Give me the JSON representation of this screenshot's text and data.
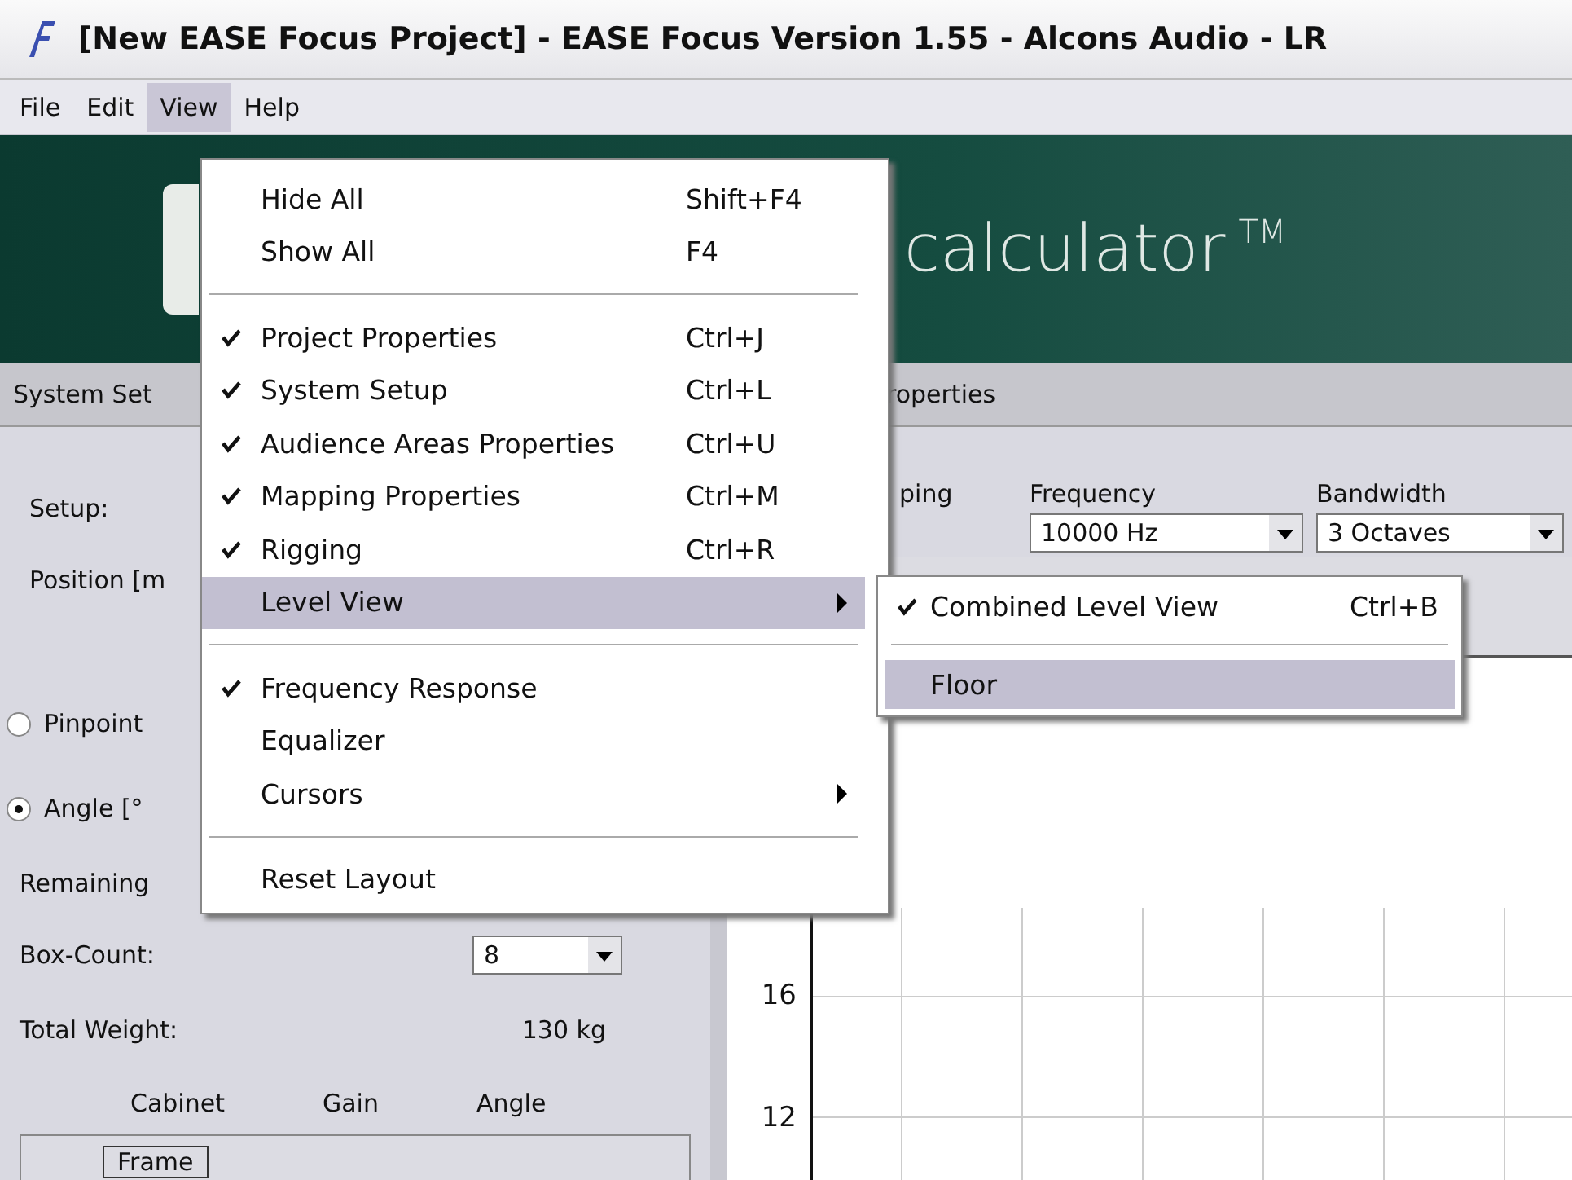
{
  "window": {
    "title": "[New EASE Focus Project] - EASE Focus Version 1.55 - Alcons Audio - LR"
  },
  "menubar": [
    {
      "label": "File",
      "selected": false
    },
    {
      "label": "Edit",
      "selected": false
    },
    {
      "label": "View",
      "selected": true
    },
    {
      "label": "Help",
      "selected": false
    }
  ],
  "banner": {
    "text": "calculator",
    "mark": "TM"
  },
  "tabs": [
    {
      "label": "System Set"
    },
    {
      "label": "roperties"
    }
  ],
  "left_panel": {
    "setup_label": "Setup:",
    "position_label": "Position [m",
    "options": [
      {
        "label": "Pinpoint",
        "selected": false
      },
      {
        "label": "Angle [°",
        "selected": true
      }
    ],
    "remaining_label": "Remaining",
    "box_count_label": "Box-Count:",
    "box_count_value": "8",
    "total_weight_label": "Total Weight:",
    "total_weight_value": "130 kg",
    "columns": [
      "Cabinet",
      "Gain",
      "Angle"
    ],
    "rows": [
      {
        "cabinet": "Frame"
      }
    ]
  },
  "right_panel": {
    "mapping_label": "ping",
    "frequency_label": "Frequency",
    "frequency_value": "10000 Hz",
    "bandwidth_label": "Bandwidth",
    "bandwidth_value": "3 Octaves",
    "y_ticks": [
      "16",
      "12"
    ]
  },
  "view_menu": [
    {
      "kind": "item",
      "label": "Hide All",
      "shortcut": "Shift+F4",
      "checked": false,
      "submenu": false,
      "selected": false
    },
    {
      "kind": "item",
      "label": "Show All",
      "shortcut": "F4",
      "checked": false,
      "submenu": false,
      "selected": false
    },
    {
      "kind": "separator"
    },
    {
      "kind": "item",
      "label": "Project Properties",
      "shortcut": "Ctrl+J",
      "checked": true,
      "submenu": false,
      "selected": false
    },
    {
      "kind": "item",
      "label": "System Setup",
      "shortcut": "Ctrl+L",
      "checked": true,
      "submenu": false,
      "selected": false
    },
    {
      "kind": "item",
      "label": "Audience Areas Properties",
      "shortcut": "Ctrl+U",
      "checked": true,
      "submenu": false,
      "selected": false
    },
    {
      "kind": "item",
      "label": "Mapping Properties",
      "shortcut": "Ctrl+M",
      "checked": true,
      "submenu": false,
      "selected": false
    },
    {
      "kind": "item",
      "label": "Rigging",
      "shortcut": "Ctrl+R",
      "checked": true,
      "submenu": false,
      "selected": false
    },
    {
      "kind": "item",
      "label": "Level View",
      "checked": false,
      "submenu": true,
      "selected": true
    },
    {
      "kind": "separator"
    },
    {
      "kind": "item",
      "label": "Frequency Response",
      "checked": true,
      "submenu": false,
      "selected": false
    },
    {
      "kind": "item",
      "label": "Equalizer",
      "checked": false,
      "submenu": false,
      "selected": false
    },
    {
      "kind": "item",
      "label": "Cursors",
      "checked": false,
      "submenu": true,
      "selected": false
    },
    {
      "kind": "separator"
    },
    {
      "kind": "item",
      "label": "Reset Layout",
      "checked": false,
      "submenu": false,
      "selected": false
    }
  ],
  "level_view_submenu": [
    {
      "kind": "item",
      "label": "Combined Level View",
      "shortcut": "Ctrl+B",
      "checked": true,
      "selected": false
    },
    {
      "kind": "separator"
    },
    {
      "kind": "item",
      "label": "Floor",
      "checked": false,
      "selected": true
    }
  ]
}
